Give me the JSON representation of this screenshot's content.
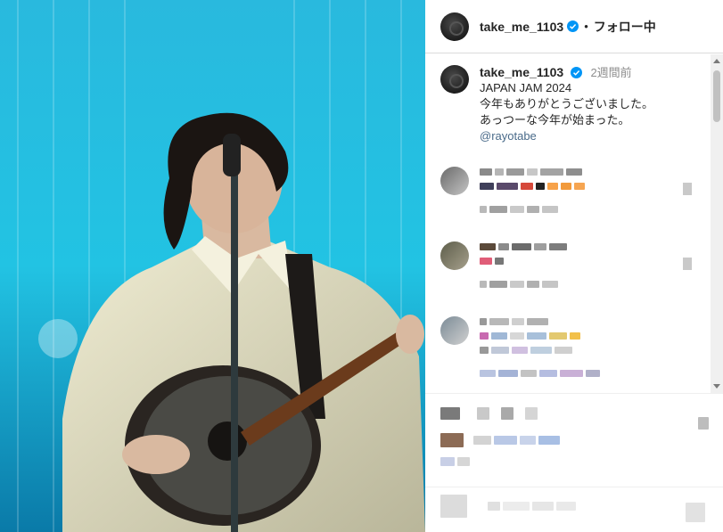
{
  "post": {
    "photo_description": "",
    "account": {
      "username": "take_me_1103",
      "verified": true,
      "follow_status": "フォロー中",
      "separator": "•"
    },
    "caption": {
      "username": "take_me_1103",
      "time_ago": "2週間前",
      "lines": [
        "JAPAN JAM 2024",
        "今年もありがとうございました。",
        "あっつーな今年が始まった。"
      ],
      "mention": "@rayotabe"
    }
  },
  "colors": {
    "verified": "#0095f6",
    "mention": "#4a6b8a",
    "sky": "#1aa7d3"
  },
  "icons": {
    "verified": "verified-badge-icon",
    "scroll_up": "chevron-up-icon",
    "scroll_down": "chevron-down-icon"
  }
}
